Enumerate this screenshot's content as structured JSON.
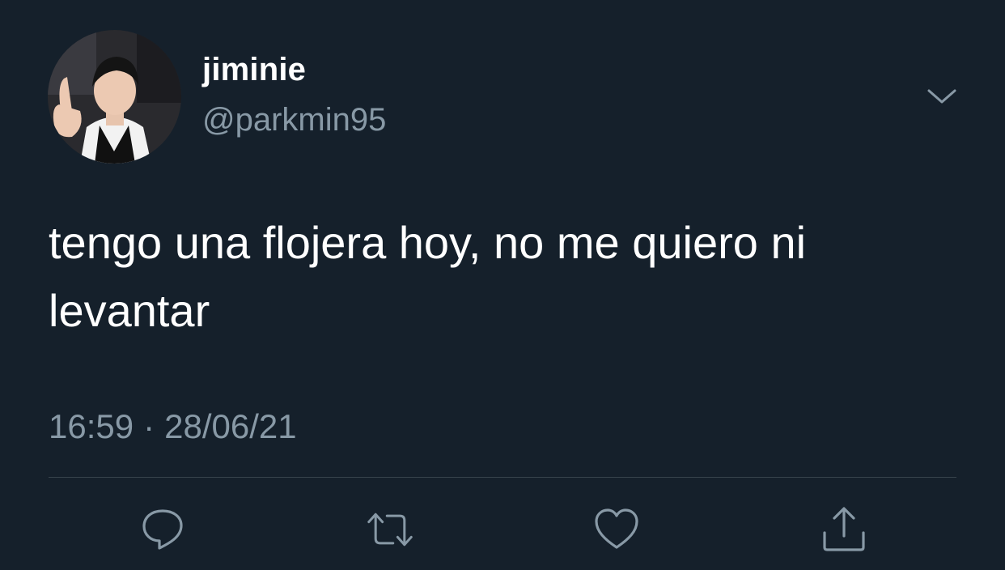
{
  "user": {
    "display_name": "jiminie",
    "handle": "@parkmin95",
    "avatar": "profile-photo"
  },
  "tweet": {
    "text": "tengo una flojera hoy, no me quiero ni levantar",
    "time": "16:59",
    "separator": "·",
    "date": "28/06/21"
  },
  "actions": [
    {
      "name": "reply",
      "icon": "comment-bubble-icon"
    },
    {
      "name": "retweet",
      "icon": "retweet-arrows-icon"
    },
    {
      "name": "like",
      "icon": "heart-icon"
    },
    {
      "name": "share",
      "icon": "share-upload-icon"
    }
  ],
  "colors": {
    "background": "#15202b",
    "primary_text": "#ffffff",
    "secondary_text": "#8899a6",
    "divider": "#38444d"
  }
}
